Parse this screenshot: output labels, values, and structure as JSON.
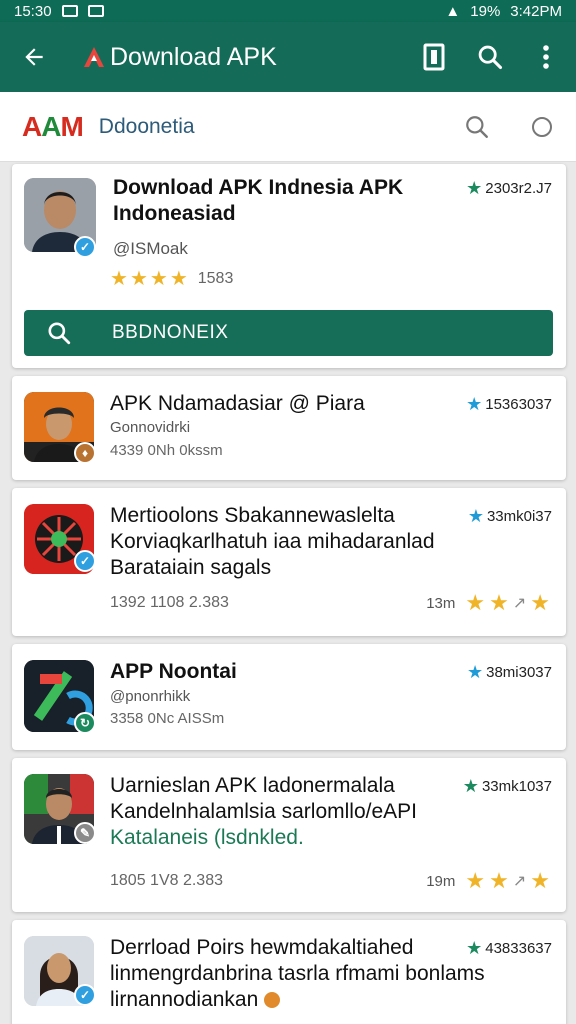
{
  "status_bar": {
    "time_left": "15:30",
    "battery": "19%",
    "time_right": "3:42PM"
  },
  "app_bar": {
    "title": "Download APK"
  },
  "sub_bar": {
    "brand_a": "A",
    "brand_b": "A",
    "brand_c": "M",
    "name": "Ddoonetia"
  },
  "featured": {
    "title": "Download APK Indnesia APK Indoneasiad",
    "handle": "@ISMoak",
    "rating_count": "1583",
    "stat": "2303r2.J7",
    "button_label": "BBDNONEIX"
  },
  "items": [
    {
      "title_lines": [
        "APK Ndamadasiar @ Piara"
      ],
      "sub": "Gonnovidrki",
      "meta": "4339 0Nh 0kssm",
      "stat": "15363037"
    },
    {
      "title_lines": [
        "Mertioolons Sbakannewaslelta",
        "Korviaqkarlhatuh iaa mihadaranlad",
        "Barataiain sagals"
      ],
      "meta_left": "1392 1108 2.383",
      "meta_right": "13m",
      "stat": "33mk0i37"
    },
    {
      "title_lines": [
        "APP Noontai"
      ],
      "sub": "@pnonrhikk",
      "meta": "3358 0Nc AISSm",
      "stat": "38mi3037"
    },
    {
      "title_lines": [
        "Uarnieslan APK ladonermalala",
        "Kandelnhalamlsia sarlomllo/eAPI",
        "Katalaneis (lsdnkled."
      ],
      "meta_left": "1805 1V8 2.383",
      "meta_right": "19m",
      "stat": "33mk1037"
    },
    {
      "title_lines": [
        "Derrload Poirs hewmdakaltiahed",
        "linmengrdanbrina tasrla rfmami bonlams",
        "lirnannodiankan"
      ],
      "stat": "43833637"
    }
  ],
  "colors": {
    "primary": "#146b58",
    "star_green": "#1b8a5e",
    "star_blue": "#1f9bd8",
    "gold": "#f0b429"
  }
}
